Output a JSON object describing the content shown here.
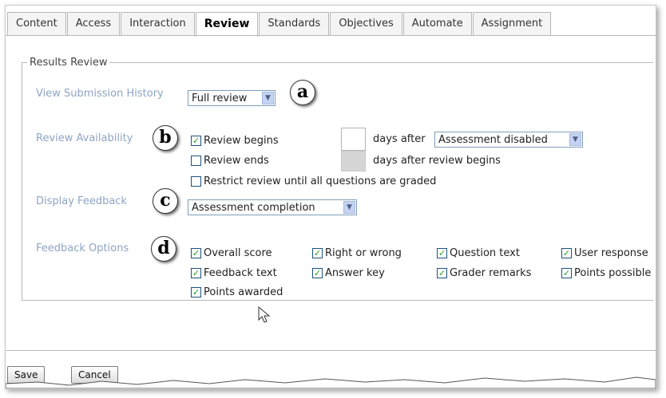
{
  "tabs": [
    "Content",
    "Access",
    "Interaction",
    "Review",
    "Standards",
    "Objectives",
    "Automate",
    "Assignment"
  ],
  "active_tab": "Review",
  "section_title": "Results Review",
  "view_history": {
    "label": "View Submission History",
    "value": "Full review",
    "callout": "a"
  },
  "review_availability": {
    "label": "Review Availability",
    "callout": "b",
    "begins_label": "Review begins",
    "ends_label": "Review ends",
    "days_after_label": "days after",
    "trigger_value": "Assessment disabled",
    "days_after_begins_label": "days after review begins",
    "restrict_label": "Restrict review until all questions are graded",
    "begins_checked": true,
    "ends_checked": false,
    "restrict_checked": false
  },
  "display_feedback": {
    "label": "Display Feedback",
    "callout": "c",
    "value": "Assessment completion"
  },
  "feedback_options": {
    "label": "Feedback Options",
    "callout": "d",
    "items": [
      {
        "label": "Overall score",
        "checked": true
      },
      {
        "label": "Right or wrong",
        "checked": true
      },
      {
        "label": "Question text",
        "checked": true
      },
      {
        "label": "User response",
        "checked": true
      },
      {
        "label": "Feedback text",
        "checked": true
      },
      {
        "label": "Answer key",
        "checked": true
      },
      {
        "label": "Grader remarks",
        "checked": true
      },
      {
        "label": "Points possible",
        "checked": true
      },
      {
        "label": "Points awarded",
        "checked": true
      }
    ]
  },
  "buttons": {
    "save": "Save",
    "cancel": "Cancel"
  },
  "colors": {
    "label_blue": "#8ea4c4",
    "check_green": "#21a121",
    "dropdown_arrow": "#c4d3f2"
  }
}
